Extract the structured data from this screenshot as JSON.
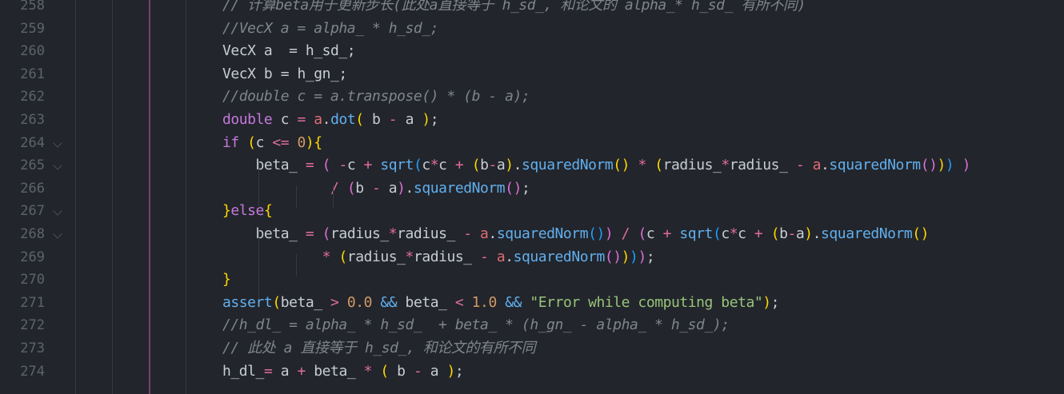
{
  "editor": {
    "lines": [
      {
        "num": "258",
        "fold": false,
        "tokens": [
          {
            "t": "// 计算beta用于更新步长(此处a直接等于 h_sd_, 和论文的 alpha_* h_sd_ 有所不同)",
            "c": "cm"
          }
        ]
      },
      {
        "num": "259",
        "fold": false,
        "tokens": [
          {
            "t": "//VecX a = alpha_ * h_sd_;",
            "c": "cm"
          }
        ]
      },
      {
        "num": "260",
        "fold": false,
        "tokens": [
          {
            "t": "VecX a  = h_sd_;",
            "c": "id2"
          }
        ]
      },
      {
        "num": "261",
        "fold": false,
        "tokens": [
          {
            "t": "VecX b = h_gn_;",
            "c": "id2"
          }
        ]
      },
      {
        "num": "262",
        "fold": false,
        "tokens": [
          {
            "t": "//double c = a.transpose() * (b - a);",
            "c": "cm"
          }
        ]
      },
      {
        "num": "263",
        "fold": false,
        "tokens": [
          {
            "t": "double",
            "c": "kw"
          },
          {
            "t": " c ",
            "c": "id2"
          },
          {
            "t": "=",
            "c": "op"
          },
          {
            "t": " ",
            "c": "id2"
          },
          {
            "t": "a",
            "c": "pr"
          },
          {
            "t": ".",
            "c": "id2"
          },
          {
            "t": "dot",
            "c": "fn"
          },
          {
            "t": "(",
            "c": "b1"
          },
          {
            "t": " b ",
            "c": "id2"
          },
          {
            "t": "-",
            "c": "op"
          },
          {
            "t": " a ",
            "c": "id2"
          },
          {
            "t": ")",
            "c": "b1"
          },
          {
            "t": ";",
            "c": "id2"
          }
        ]
      },
      {
        "num": "264",
        "fold": true,
        "tokens": [
          {
            "t": "if",
            "c": "kw"
          },
          {
            "t": " ",
            "c": "id2"
          },
          {
            "t": "(",
            "c": "b1"
          },
          {
            "t": "c ",
            "c": "id2"
          },
          {
            "t": "<=",
            "c": "op"
          },
          {
            "t": " ",
            "c": "id2"
          },
          {
            "t": "0",
            "c": "num"
          },
          {
            "t": ")",
            "c": "b1"
          },
          {
            "t": "{",
            "c": "b1"
          }
        ]
      },
      {
        "num": "265",
        "fold": true,
        "tokens": [
          {
            "t": "    beta_ ",
            "c": "id2"
          },
          {
            "t": "=",
            "c": "op"
          },
          {
            "t": " ",
            "c": "id2"
          },
          {
            "t": "(",
            "c": "b2"
          },
          {
            "t": " ",
            "c": "id2"
          },
          {
            "t": "-",
            "c": "op"
          },
          {
            "t": "c ",
            "c": "id2"
          },
          {
            "t": "+",
            "c": "op"
          },
          {
            "t": " ",
            "c": "id2"
          },
          {
            "t": "sqrt",
            "c": "fn"
          },
          {
            "t": "(",
            "c": "b3"
          },
          {
            "t": "c",
            "c": "id2"
          },
          {
            "t": "*",
            "c": "op"
          },
          {
            "t": "c ",
            "c": "id2"
          },
          {
            "t": "+",
            "c": "op"
          },
          {
            "t": " ",
            "c": "id2"
          },
          {
            "t": "(",
            "c": "b1"
          },
          {
            "t": "b",
            "c": "id2"
          },
          {
            "t": "-",
            "c": "op"
          },
          {
            "t": "a",
            "c": "id2"
          },
          {
            "t": ")",
            "c": "b1"
          },
          {
            "t": ".",
            "c": "id2"
          },
          {
            "t": "squaredNorm",
            "c": "fn"
          },
          {
            "t": "()",
            "c": "b1"
          },
          {
            "t": " ",
            "c": "id2"
          },
          {
            "t": "*",
            "c": "op"
          },
          {
            "t": " ",
            "c": "id2"
          },
          {
            "t": "(",
            "c": "b1"
          },
          {
            "t": "radius_",
            "c": "id2"
          },
          {
            "t": "*",
            "c": "op"
          },
          {
            "t": "radius_ ",
            "c": "id2"
          },
          {
            "t": "-",
            "c": "op"
          },
          {
            "t": " ",
            "c": "id2"
          },
          {
            "t": "a",
            "c": "pr"
          },
          {
            "t": ".",
            "c": "id2"
          },
          {
            "t": "squaredNorm",
            "c": "fn"
          },
          {
            "t": "()",
            "c": "b2"
          },
          {
            "t": ")",
            "c": "b1"
          },
          {
            "t": ")",
            "c": "b3"
          },
          {
            "t": " ",
            "c": "id2"
          },
          {
            "t": ")",
            "c": "b2"
          }
        ]
      },
      {
        "num": "266",
        "fold": false,
        "tokens": [
          {
            "t": "             ",
            "c": "id2"
          },
          {
            "t": "/",
            "c": "op"
          },
          {
            "t": " ",
            "c": "id2"
          },
          {
            "t": "(",
            "c": "b2"
          },
          {
            "t": "b ",
            "c": "id2"
          },
          {
            "t": "-",
            "c": "op"
          },
          {
            "t": " a",
            "c": "id2"
          },
          {
            "t": ")",
            "c": "b2"
          },
          {
            "t": ".",
            "c": "id2"
          },
          {
            "t": "squaredNorm",
            "c": "fn"
          },
          {
            "t": "()",
            "c": "b2"
          },
          {
            "t": ";",
            "c": "id2"
          }
        ]
      },
      {
        "num": "267",
        "fold": true,
        "tokens": [
          {
            "t": "}",
            "c": "b1"
          },
          {
            "t": "else",
            "c": "kw"
          },
          {
            "t": "{",
            "c": "b1"
          }
        ]
      },
      {
        "num": "268",
        "fold": true,
        "tokens": [
          {
            "t": "    beta_ ",
            "c": "id2"
          },
          {
            "t": "=",
            "c": "op"
          },
          {
            "t": " ",
            "c": "id2"
          },
          {
            "t": "(",
            "c": "b2"
          },
          {
            "t": "radius_",
            "c": "id2"
          },
          {
            "t": "*",
            "c": "op"
          },
          {
            "t": "radius_ ",
            "c": "id2"
          },
          {
            "t": "-",
            "c": "op"
          },
          {
            "t": " ",
            "c": "id2"
          },
          {
            "t": "a",
            "c": "pr"
          },
          {
            "t": ".",
            "c": "id2"
          },
          {
            "t": "squaredNorm",
            "c": "fn"
          },
          {
            "t": "()",
            "c": "b3"
          },
          {
            "t": ")",
            "c": "b2"
          },
          {
            "t": " ",
            "c": "id2"
          },
          {
            "t": "/",
            "c": "op"
          },
          {
            "t": " ",
            "c": "id2"
          },
          {
            "t": "(",
            "c": "b2"
          },
          {
            "t": "c ",
            "c": "id2"
          },
          {
            "t": "+",
            "c": "op"
          },
          {
            "t": " ",
            "c": "id2"
          },
          {
            "t": "sqrt",
            "c": "fn"
          },
          {
            "t": "(",
            "c": "b3"
          },
          {
            "t": "c",
            "c": "id2"
          },
          {
            "t": "*",
            "c": "op"
          },
          {
            "t": "c ",
            "c": "id2"
          },
          {
            "t": "+",
            "c": "op"
          },
          {
            "t": " ",
            "c": "id2"
          },
          {
            "t": "(",
            "c": "b1"
          },
          {
            "t": "b",
            "c": "id2"
          },
          {
            "t": "-",
            "c": "op"
          },
          {
            "t": "a",
            "c": "id2"
          },
          {
            "t": ")",
            "c": "b1"
          },
          {
            "t": ".",
            "c": "id2"
          },
          {
            "t": "squaredNorm",
            "c": "fn"
          },
          {
            "t": "()",
            "c": "b1"
          }
        ]
      },
      {
        "num": "269",
        "fold": false,
        "tokens": [
          {
            "t": "            ",
            "c": "id2"
          },
          {
            "t": "*",
            "c": "op"
          },
          {
            "t": " ",
            "c": "id2"
          },
          {
            "t": "(",
            "c": "b1"
          },
          {
            "t": "radius_",
            "c": "id2"
          },
          {
            "t": "*",
            "c": "op"
          },
          {
            "t": "radius_ ",
            "c": "id2"
          },
          {
            "t": "-",
            "c": "op"
          },
          {
            "t": " ",
            "c": "id2"
          },
          {
            "t": "a",
            "c": "pr"
          },
          {
            "t": ".",
            "c": "id2"
          },
          {
            "t": "squaredNorm",
            "c": "fn"
          },
          {
            "t": "()",
            "c": "b2"
          },
          {
            "t": ")",
            "c": "b1"
          },
          {
            "t": ")",
            "c": "b3"
          },
          {
            "t": ")",
            "c": "b2"
          },
          {
            "t": ";",
            "c": "id2"
          }
        ]
      },
      {
        "num": "270",
        "fold": false,
        "tokens": [
          {
            "t": "}",
            "c": "b1"
          }
        ]
      },
      {
        "num": "271",
        "fold": false,
        "tokens": [
          {
            "t": "assert",
            "c": "fn"
          },
          {
            "t": "(",
            "c": "b1"
          },
          {
            "t": "beta_ ",
            "c": "id2"
          },
          {
            "t": ">",
            "c": "op"
          },
          {
            "t": " ",
            "c": "id2"
          },
          {
            "t": "0.0",
            "c": "num"
          },
          {
            "t": " ",
            "c": "id2"
          },
          {
            "t": "&&",
            "c": "fn"
          },
          {
            "t": " beta_ ",
            "c": "id2"
          },
          {
            "t": "<",
            "c": "op"
          },
          {
            "t": " ",
            "c": "id2"
          },
          {
            "t": "1.0",
            "c": "num"
          },
          {
            "t": " ",
            "c": "id2"
          },
          {
            "t": "&&",
            "c": "fn"
          },
          {
            "t": " ",
            "c": "id2"
          },
          {
            "t": "\"Error while computing beta\"",
            "c": "str"
          },
          {
            "t": ")",
            "c": "b1"
          },
          {
            "t": ";",
            "c": "id2"
          }
        ]
      },
      {
        "num": "272",
        "fold": false,
        "tokens": [
          {
            "t": "//h_dl_ = alpha_ * h_sd_  + beta_ * (h_gn_ - alpha_ * h_sd_);",
            "c": "cm"
          }
        ]
      },
      {
        "num": "273",
        "fold": false,
        "tokens": [
          {
            "t": "// 此处 a 直接等于 h_sd_, 和论文的有所不同",
            "c": "cm"
          }
        ]
      },
      {
        "num": "274",
        "fold": false,
        "tokens": [
          {
            "t": "h_dl_",
            "c": "id2"
          },
          {
            "t": "=",
            "c": "op"
          },
          {
            "t": " a ",
            "c": "id2"
          },
          {
            "t": "+",
            "c": "op"
          },
          {
            "t": " beta_ ",
            "c": "id2"
          },
          {
            "t": "*",
            "c": "op"
          },
          {
            "t": " ",
            "c": "id2"
          },
          {
            "t": "(",
            "c": "b1"
          },
          {
            "t": " b ",
            "c": "id2"
          },
          {
            "t": "-",
            "c": "op"
          },
          {
            "t": " a ",
            "c": "id2"
          },
          {
            "t": ")",
            "c": "b1"
          },
          {
            "t": ";",
            "c": "id2"
          }
        ]
      }
    ]
  }
}
